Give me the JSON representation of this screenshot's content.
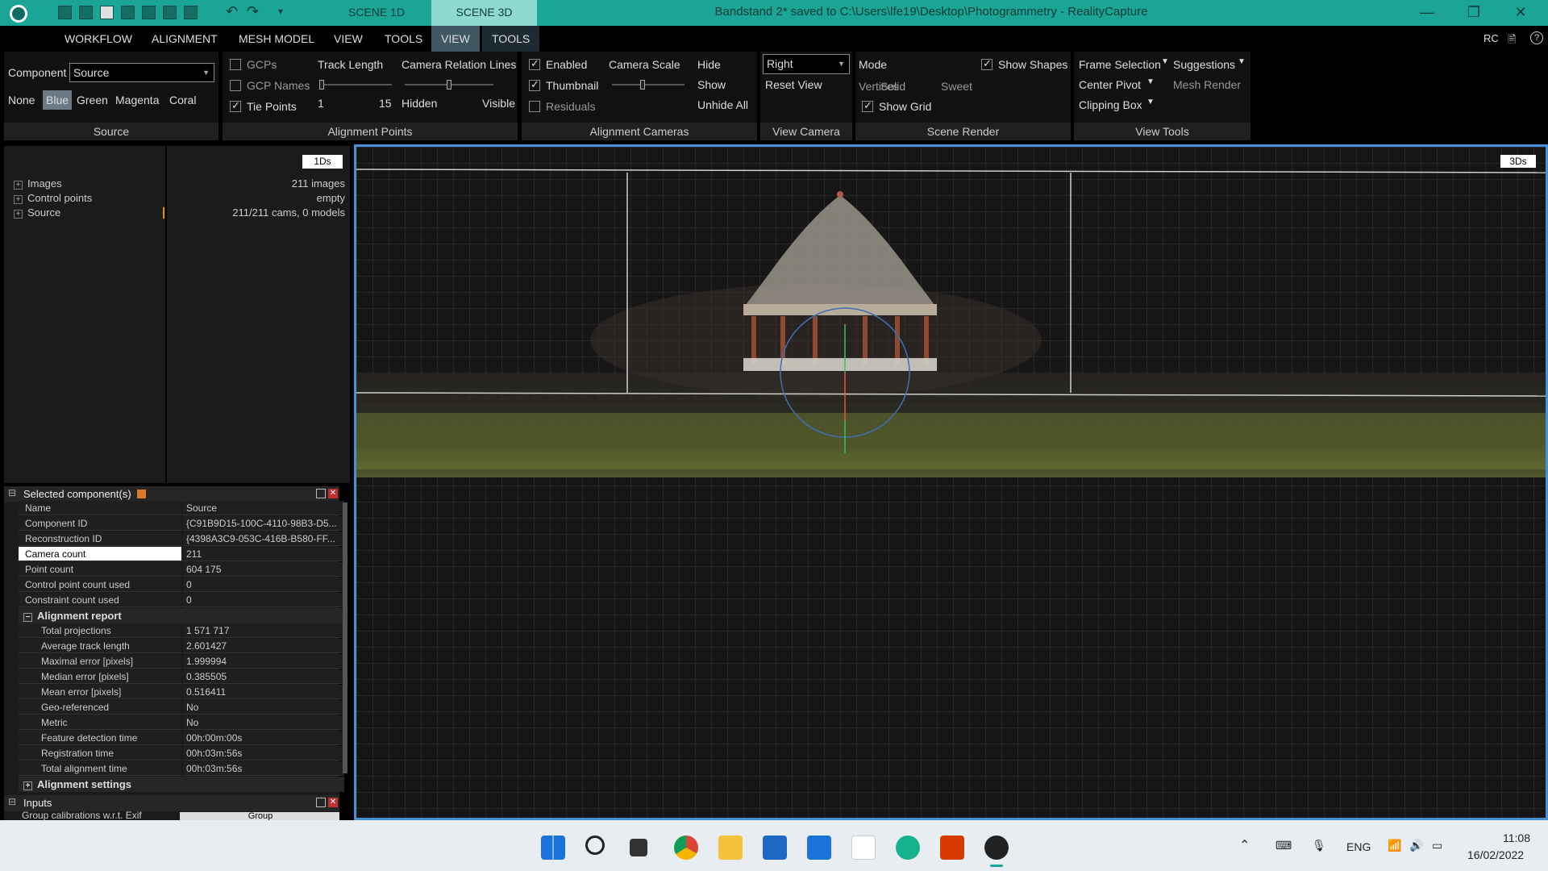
{
  "titlebar": {
    "scene_tabs": [
      "SCENE 1D",
      "SCENE 3D"
    ],
    "title": "Bandstand 2* saved to C:\\Users\\lfe19\\Desktop\\Photogrammetry - RealityCapture",
    "win_controls": [
      "—",
      "❐",
      "✕"
    ]
  },
  "menubar": {
    "items": [
      "WORKFLOW",
      "ALIGNMENT",
      "MESH MODEL",
      "VIEW",
      "TOOLS",
      "VIEW",
      "TOOLS"
    ],
    "right": [
      "RC",
      "🗎",
      "?"
    ]
  },
  "ribbon": {
    "source": {
      "component_label": "Component",
      "component_value": "Source",
      "colors": [
        "None",
        "Blue",
        "Green",
        "Magenta",
        "Coral"
      ],
      "footer": "Source"
    },
    "alignment_points": {
      "gcps": "GCPs",
      "gcp_names": "GCP Names",
      "tie_points": "Tie Points",
      "track_length": "Track Length",
      "track_min": "1",
      "track_max": "15",
      "relation_lines": "Camera Relation Lines",
      "hidden": "Hidden",
      "visible": "Visible",
      "footer": "Alignment Points"
    },
    "alignment_cameras": {
      "enabled": "Enabled",
      "thumbnail": "Thumbnail",
      "residuals": "Residuals",
      "camera_scale": "Camera Scale",
      "hide": "Hide",
      "show": "Show",
      "unhide_all": "Unhide All",
      "footer": "Alignment Cameras"
    },
    "view_camera": {
      "view_value": "Right",
      "reset_view": "Reset View",
      "footer": "View Camera"
    },
    "scene_render": {
      "mode": "Mode",
      "modes": [
        "Vertices",
        "Solid",
        "Sweet"
      ],
      "show_shapes": "Show Shapes",
      "show_grid": "Show Grid",
      "footer": "Scene Render"
    },
    "view_tools": {
      "frame_selection": "Frame Selection",
      "suggestions": "Suggestions",
      "center_pivot": "Center Pivot",
      "mesh_render": "Mesh Render",
      "clipping_box": "Clipping Box",
      "footer": "View Tools"
    }
  },
  "panel_1ds": {
    "badge": "1Ds",
    "tree": [
      {
        "label": "Images",
        "value": "211 images"
      },
      {
        "label": "Control points",
        "value": "empty"
      },
      {
        "label": "Source",
        "value": "211/211 cams, 0 models"
      }
    ]
  },
  "properties": {
    "title": "Selected component(s)",
    "rows": [
      {
        "k": "Name",
        "v": "Source"
      },
      {
        "k": "Component ID",
        "v": "{C91B9D15-100C-4110-98B3-D5..."
      },
      {
        "k": "Reconstruction ID",
        "v": "{4398A3C9-053C-416B-B580-FF..."
      },
      {
        "k": "Camera count",
        "v": "211"
      },
      {
        "k": "Point count",
        "v": "604 175"
      },
      {
        "k": "Control point count used",
        "v": "0"
      },
      {
        "k": "Constraint count used",
        "v": "0"
      }
    ],
    "report_title": "Alignment report",
    "report": [
      {
        "k": "Total projections",
        "v": "1 571 717"
      },
      {
        "k": "Average track length",
        "v": "2.601427"
      },
      {
        "k": "Maximal error [pixels]",
        "v": "1.999994"
      },
      {
        "k": "Median error [pixels]",
        "v": "0.385505"
      },
      {
        "k": "Mean error [pixels]",
        "v": "0.516411"
      },
      {
        "k": "Geo-referenced",
        "v": "No"
      },
      {
        "k": "Metric",
        "v": "No"
      },
      {
        "k": "Feature detection time",
        "v": "00h:00m:00s"
      },
      {
        "k": "Registration time",
        "v": "00h:03m:56s"
      },
      {
        "k": "Total alignment time",
        "v": "00h:03m:56s"
      }
    ],
    "settings_title": "Alignment settings",
    "inputs_title": "Inputs",
    "inputs_row_k": "Group calibrations w.r.t. Exif",
    "inputs_row_v": "Group"
  },
  "viewport": {
    "badge": "3Ds"
  },
  "taskbar": {
    "lang": "ENG",
    "time": "11:08",
    "date": "16/02/2022"
  },
  "colors": {
    "titlebar": "#1aa596",
    "accent_blue": "#4a90d9",
    "active_menu": "#3e5763"
  }
}
